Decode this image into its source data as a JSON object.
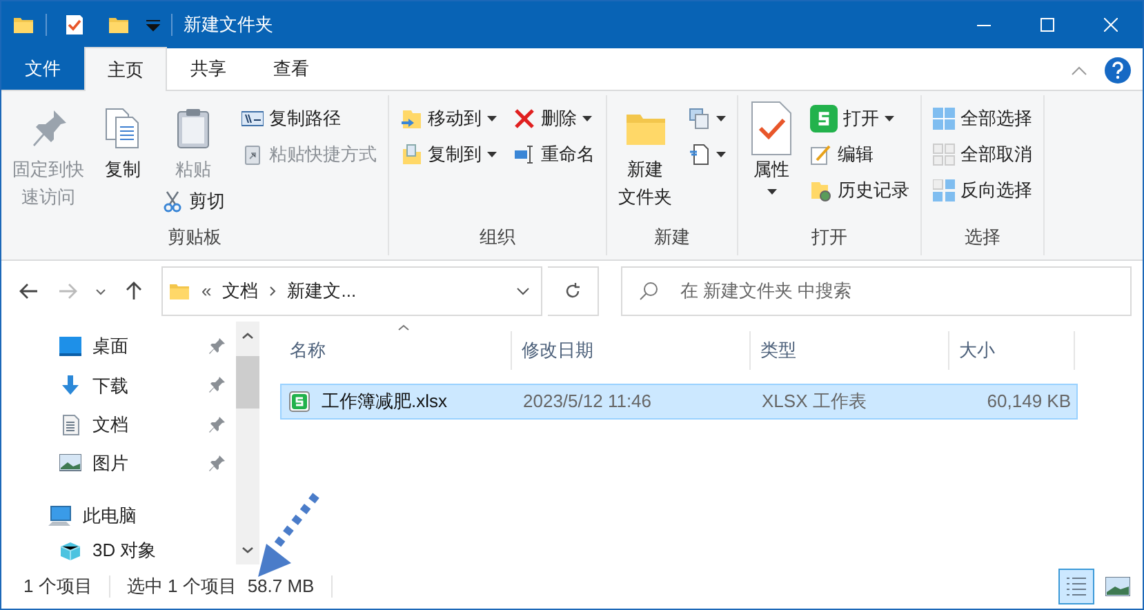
{
  "window": {
    "title": "新建文件夹"
  },
  "menu_tabs": [
    {
      "label": "文件",
      "kind": "file",
      "selected": false
    },
    {
      "label": "主页",
      "kind": "tab",
      "selected": true
    },
    {
      "label": "共享",
      "kind": "tab",
      "selected": false
    },
    {
      "label": "查看",
      "kind": "tab",
      "selected": false
    }
  ],
  "ribbon": {
    "groups": [
      {
        "label": "剪贴板",
        "columns": [
          [
            {
              "kind": "large",
              "lines": [
                "固定到快",
                "速访问"
              ],
              "disabled": true,
              "dropdown": false
            }
          ],
          [
            {
              "kind": "large",
              "lines": [
                "复制"
              ],
              "disabled": false,
              "dropdown": false
            }
          ],
          [
            {
              "kind": "large",
              "lines": [
                "粘贴"
              ],
              "disabled": true,
              "dropdown": false
            },
            {
              "kind": "small",
              "lines": [
                "剪切"
              ],
              "disabled": false,
              "dropdown": false
            }
          ],
          [
            {
              "kind": "small",
              "lines": [
                "复制路径"
              ],
              "disabled": false,
              "dropdown": false
            },
            {
              "kind": "small",
              "lines": [
                "粘贴快捷方式"
              ],
              "disabled": true,
              "dropdown": false
            }
          ]
        ]
      },
      {
        "label": "组织",
        "columns": [
          [
            {
              "kind": "small",
              "lines": [
                "移动到"
              ],
              "disabled": false,
              "dropdown": true
            },
            {
              "kind": "small",
              "lines": [
                "复制到"
              ],
              "disabled": false,
              "dropdown": true
            }
          ],
          [
            {
              "kind": "small",
              "lines": [
                "删除"
              ],
              "disabled": false,
              "dropdown": true
            },
            {
              "kind": "small",
              "lines": [
                "重命名"
              ],
              "disabled": false,
              "dropdown": false
            }
          ]
        ]
      },
      {
        "label": "新建",
        "columns": [
          [
            {
              "kind": "large",
              "lines": [
                "新建",
                "文件夹"
              ],
              "disabled": false,
              "dropdown": false
            }
          ],
          [
            {
              "kind": "icon",
              "disabled": false,
              "dropdown": true
            },
            {
              "kind": "icon",
              "disabled": false,
              "dropdown": true
            }
          ]
        ]
      },
      {
        "label": "打开",
        "columns": [
          [
            {
              "kind": "large",
              "lines": [
                "属性"
              ],
              "disabled": false,
              "dropdown": true
            }
          ],
          [
            {
              "kind": "small",
              "lines": [
                "打开"
              ],
              "disabled": false,
              "dropdown": true
            },
            {
              "kind": "small",
              "lines": [
                "编辑"
              ],
              "disabled": false,
              "dropdown": false
            },
            {
              "kind": "small",
              "lines": [
                "历史记录"
              ],
              "disabled": false,
              "dropdown": false
            }
          ]
        ]
      },
      {
        "label": "选择",
        "columns": [
          [
            {
              "kind": "small",
              "lines": [
                "全部选择"
              ],
              "disabled": false,
              "dropdown": false
            },
            {
              "kind": "small",
              "lines": [
                "全部取消"
              ],
              "disabled": false,
              "dropdown": false
            },
            {
              "kind": "small",
              "lines": [
                "反向选择"
              ],
              "disabled": false,
              "dropdown": false
            }
          ]
        ]
      }
    ]
  },
  "address_bar": {
    "back_disabled": false,
    "forward_disabled": true,
    "breadcrumb": [
      "«",
      "文档",
      "新建文..."
    ]
  },
  "search": {
    "placeholder": "在 新建文件夹 中搜索"
  },
  "navigation": {
    "quick_access": [
      {
        "label": "桌面",
        "pinned": true
      },
      {
        "label": "下载",
        "pinned": true
      },
      {
        "label": "文档",
        "pinned": true
      },
      {
        "label": "图片",
        "pinned": true
      }
    ],
    "this_pc": {
      "label": "此电脑",
      "children": [
        {
          "label": "3D 对象"
        }
      ]
    }
  },
  "file_list": {
    "columns": [
      "名称",
      "修改日期",
      "类型",
      "大小"
    ],
    "rows": [
      {
        "name": "工作簿减肥.xlsx",
        "modified": "2023/5/12 11:46",
        "type": "XLSX 工作表",
        "size": "60,149 KB",
        "selected": true
      }
    ]
  },
  "status_bar": {
    "item_count": "1 个项目",
    "selection": "选中 1 个项目",
    "selection_size": "58.7 MB",
    "views": [
      {
        "kind": "details",
        "selected": true
      },
      {
        "kind": "large_icons",
        "selected": false
      }
    ]
  }
}
